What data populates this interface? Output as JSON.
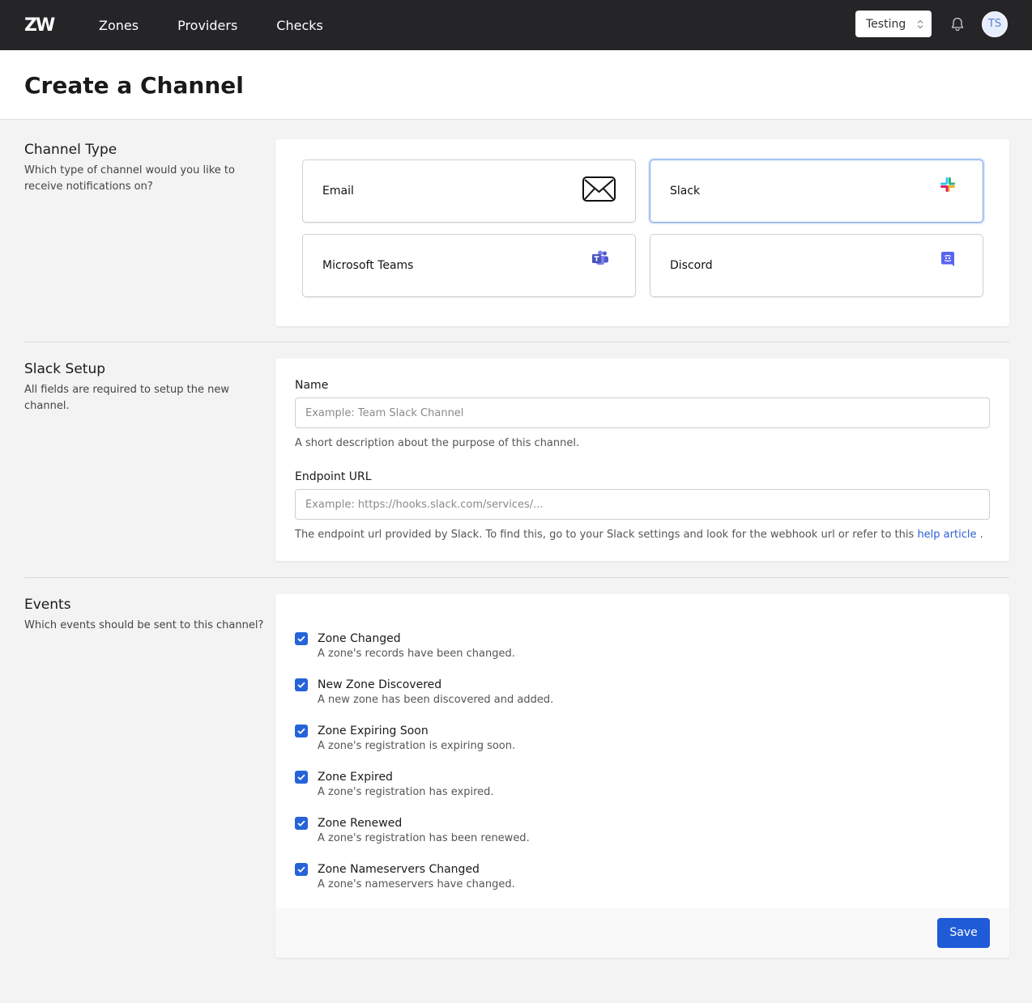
{
  "nav": {
    "logo": "ZW",
    "links": [
      "Zones",
      "Providers",
      "Checks"
    ],
    "environment": "Testing",
    "avatar_initials": "TS"
  },
  "page": {
    "title": "Create a Channel"
  },
  "channel_type": {
    "title": "Channel Type",
    "description": "Which type of channel would you like to receive notifications on?",
    "options": [
      {
        "label": "Email",
        "icon": "envelope-icon"
      },
      {
        "label": "Slack",
        "icon": "slack-icon",
        "selected": true
      },
      {
        "label": "Microsoft Teams",
        "icon": "teams-icon"
      },
      {
        "label": "Discord",
        "icon": "discord-icon"
      }
    ]
  },
  "setup": {
    "title": "Slack Setup",
    "description": "All fields are required to setup the new channel.",
    "name_label": "Name",
    "name_placeholder": "Example: Team Slack Channel",
    "name_help": "A short description about the purpose of this channel.",
    "url_label": "Endpoint URL",
    "url_placeholder": "Example: https://hooks.slack.com/services/...",
    "url_help": "The endpoint url provided by Slack. To find this, go to your Slack settings and look for the webhook url or refer to this",
    "url_help_link": "help article",
    "url_help_end": "."
  },
  "events": {
    "title": "Events",
    "description": "Which events should be sent to this channel?",
    "items": [
      {
        "title": "Zone Changed",
        "desc": "A zone's records have been changed.",
        "checked": true
      },
      {
        "title": "New Zone Discovered",
        "desc": "A new zone has been discovered and added.",
        "checked": true
      },
      {
        "title": "Zone Expiring Soon",
        "desc": "A zone's registration is expiring soon.",
        "checked": true
      },
      {
        "title": "Zone Expired",
        "desc": "A zone's registration has expired.",
        "checked": true
      },
      {
        "title": "Zone Renewed",
        "desc": "A zone's registration has been renewed.",
        "checked": true
      },
      {
        "title": "Zone Nameservers Changed",
        "desc": "A zone's nameservers have changed.",
        "checked": true
      }
    ],
    "save_label": "Save"
  },
  "colors": {
    "nav_bg": "#252528",
    "accent": "#1f5bd6",
    "selected_border": "#7aa2e8"
  }
}
